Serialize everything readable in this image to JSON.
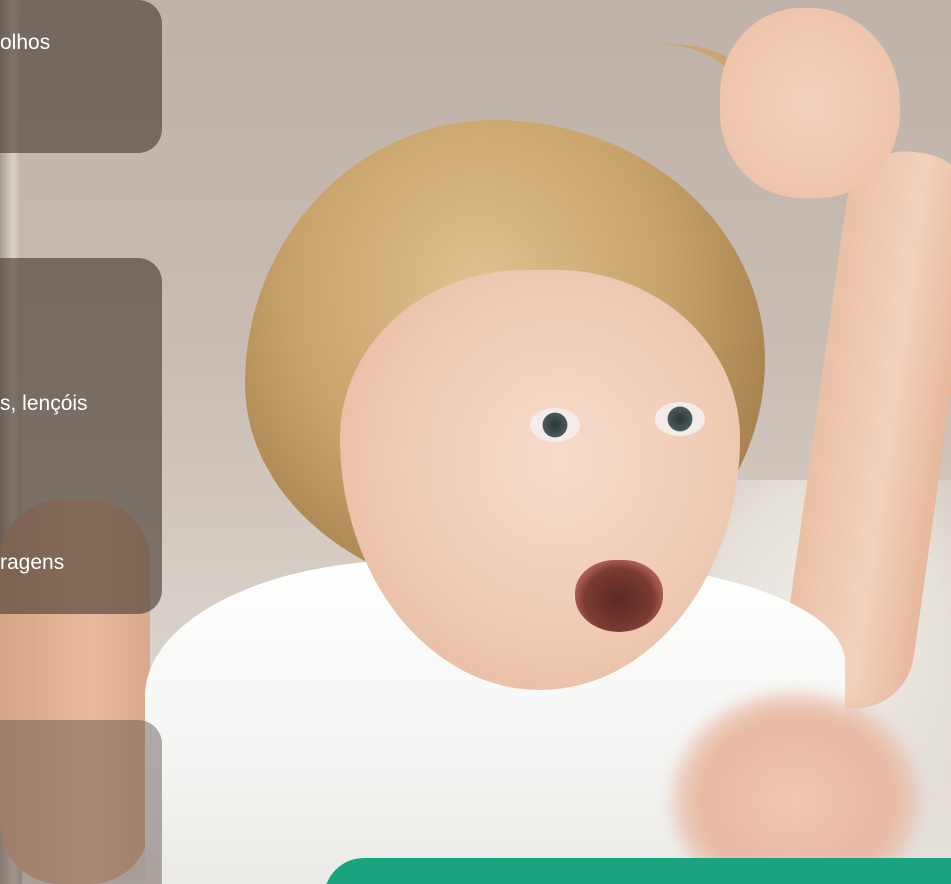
{
  "cards": [
    {
      "text": "olhos"
    },
    {
      "lines": [
        "s, lençóis",
        "ragens"
      ]
    },
    {
      "text": ""
    }
  ],
  "colors": {
    "card_overlay": "#463a30",
    "accent_green": "#1aa37f"
  },
  "image": {
    "subject_icon": "child-pulling-hair-photo"
  }
}
